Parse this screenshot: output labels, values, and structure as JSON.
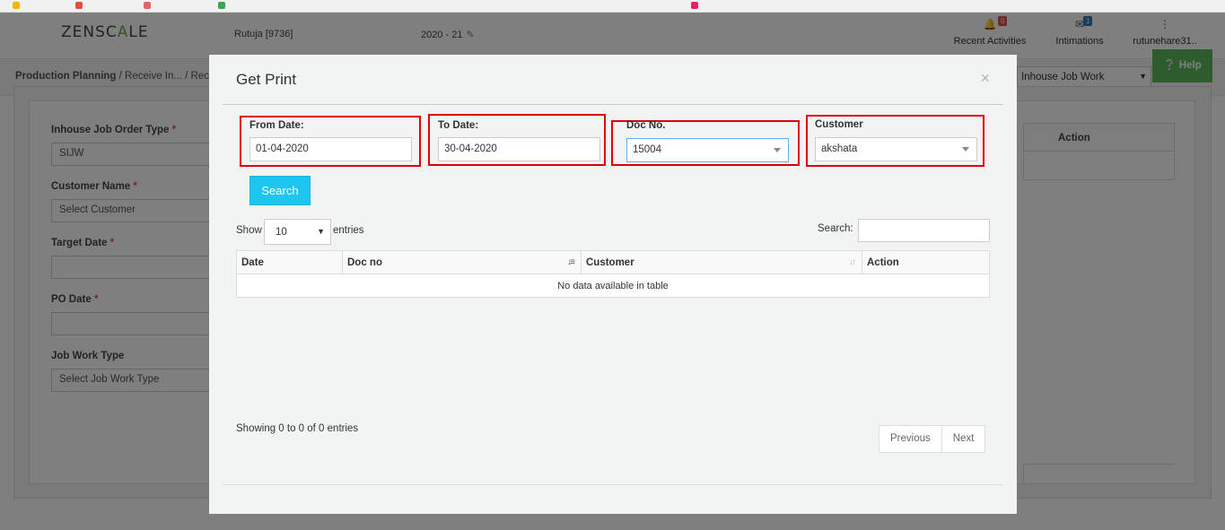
{
  "app": {
    "logo_text": "ZENSC",
    "logo_accent": "A",
    "logo_text_end": "LE",
    "user_code": "Rutuja [9736]",
    "financial_year": "2020 - 21",
    "nav": {
      "recent_label": "Recent Activities",
      "recent_count": "0",
      "intimations_label": "Intimations",
      "intimations_count": "1",
      "user_label": "rutunehare31.."
    },
    "breadcrumb": {
      "part1": "Production Planning",
      "part2": "/ Receive In...",
      "part3": "/ Rec"
    },
    "job_work_select": "Inhouse Job Work",
    "help_label": "Help",
    "form": {
      "order_type_label": "Inhouse Job Order Type",
      "order_type_value": "SIJW",
      "customer_label": "Customer Name",
      "customer_placeholder": "Select Customer",
      "target_date_label": "Target Date",
      "po_date_label": "PO Date",
      "job_work_type_label": "Job Work Type",
      "job_work_type_placeholder": "Select Job Work Type",
      "required_mark": "*"
    },
    "bg_table_action": "Action"
  },
  "modal": {
    "title": "Get Print",
    "close": "×",
    "from_date": {
      "label": "From Date:",
      "value": "01-04-2020"
    },
    "to_date": {
      "label": "To Date:",
      "value": "30-04-2020"
    },
    "doc_no": {
      "label": "Doc No.",
      "value": "15004"
    },
    "customer": {
      "label": "Customer",
      "value": "akshata"
    },
    "search_button": "Search",
    "length": {
      "show_label": "Show",
      "value": "10",
      "entries_label": "entries"
    },
    "filter_label": "Search:",
    "table": {
      "columns": [
        "Date",
        "Doc no",
        "Customer",
        "Action"
      ],
      "empty_message": "No data available in table"
    },
    "info": "Showing 0 to 0 of 0 entries",
    "pagination": {
      "previous": "Previous",
      "next": "Next"
    }
  },
  "colors": {
    "highlight_border": "#e00000",
    "search_button": "#1ec5ef",
    "help_button": "#5cb85c"
  }
}
